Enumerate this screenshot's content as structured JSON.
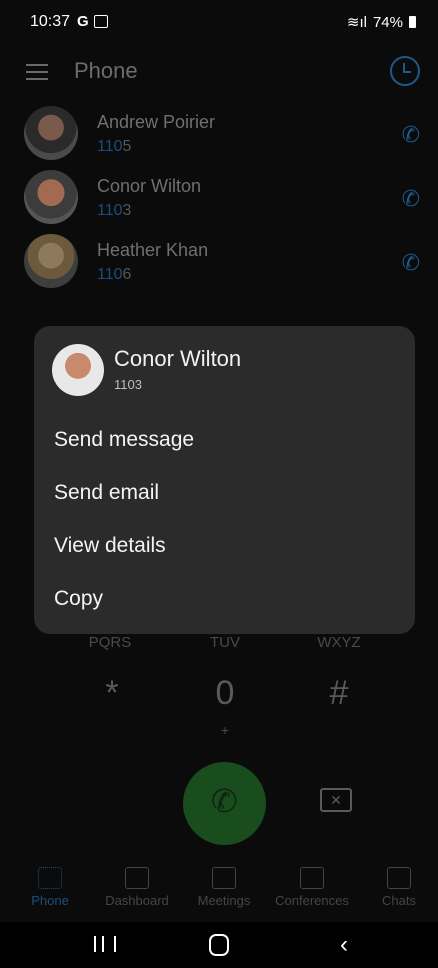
{
  "status": {
    "time": "10:37",
    "battery": "74%"
  },
  "header": {
    "title": "Phone"
  },
  "contacts": [
    {
      "name": "Andrew Poirier",
      "ext_prefix": "110",
      "ext_suffix": "5"
    },
    {
      "name": "Conor Wilton",
      "ext_prefix": "110",
      "ext_suffix": "3"
    },
    {
      "name": "Heather Khan",
      "ext_prefix": "110",
      "ext_suffix": "6"
    }
  ],
  "keypad": {
    "pqrs": "PQRS",
    "tuv": "TUV",
    "wxyz": "WXYZ",
    "star": "*",
    "zero": "0",
    "hash": "#",
    "plus": "+"
  },
  "tabs": {
    "phone": "Phone",
    "dashboard": "Dashboard",
    "meetings": "Meetings",
    "conferences": "Conferences",
    "chats": "Chats"
  },
  "popup": {
    "name": "Conor Wilton",
    "ext": "1103",
    "items": [
      "Send message",
      "Send email",
      "View details",
      "Copy"
    ]
  }
}
